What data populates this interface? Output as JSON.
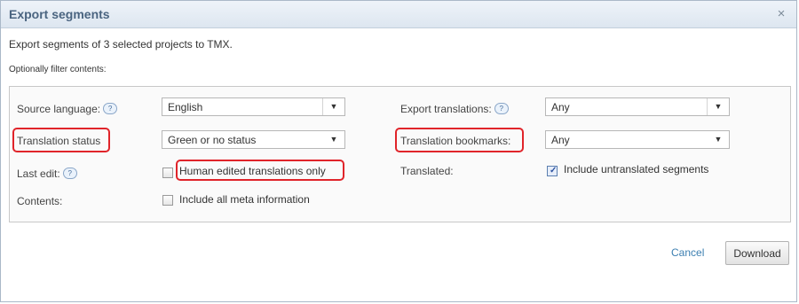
{
  "dialog": {
    "title": "Export segments",
    "close_glyph": "×",
    "intro": "Export segments of 3 selected projects to TMX.",
    "optional": "Optionally filter contents:"
  },
  "filters": {
    "source_language": {
      "label": "Source language:",
      "value": "English",
      "help": "?"
    },
    "translation_status": {
      "label": "Translation status",
      "value": "Green or no status"
    },
    "last_edit": {
      "label": "Last edit:",
      "help": "?",
      "checkbox_label": "Human edited translations only",
      "checked": false
    },
    "contents": {
      "label": "Contents:",
      "checkbox_label": "Include all meta information",
      "checked": false
    },
    "export_translations": {
      "label": "Export translations:",
      "value": "Any",
      "help": "?"
    },
    "translation_bookmarks": {
      "label": "Translation bookmarks:",
      "value": "Any"
    },
    "translated": {
      "label": "Translated:",
      "checkbox_label": "Include untranslated segments",
      "checked": true
    }
  },
  "footer": {
    "cancel_label": "Cancel",
    "download_label": "Download"
  },
  "icons": {
    "select_arrow": "▼",
    "check": "✓"
  },
  "colors": {
    "title": "#4a6480",
    "highlight": "#e0242a",
    "link": "#3c7fb1"
  }
}
